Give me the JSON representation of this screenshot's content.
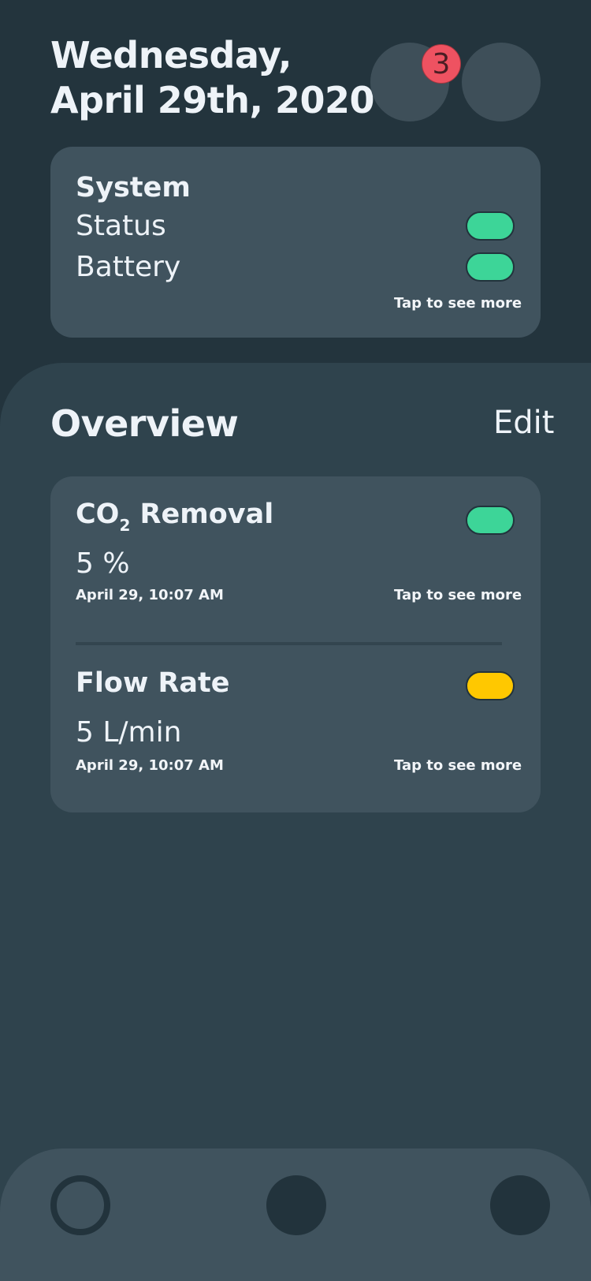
{
  "header": {
    "date_line1": "Wednesday,",
    "date_line2": "April 29th, 2020",
    "notification_count": "3"
  },
  "system_card": {
    "title": "System",
    "status_label": "Status",
    "status_color": "#3dd598",
    "battery_label": "Battery",
    "battery_color": "#3dd598",
    "tap_hint": "Tap to see more"
  },
  "overview": {
    "title": "Overview",
    "edit_label": "Edit",
    "items": [
      {
        "title_prefix": "CO",
        "title_sub": "2",
        "title_suffix": " Removal",
        "value": "5 %",
        "timestamp": "April 29, 10:07 AM",
        "tap_hint": "Tap to see more",
        "status_color": "#3dd598"
      },
      {
        "title": "Flow Rate",
        "value": "5 L/min",
        "timestamp": "April 29, 10:07 AM",
        "tap_hint": "Tap to see more",
        "status_color": "#ffc800"
      }
    ]
  },
  "tabbar": {
    "tabs": [
      {
        "icon": "home-tab-icon",
        "active": true
      },
      {
        "icon": "tab-2-icon",
        "active": false
      },
      {
        "icon": "tab-3-icon",
        "active": false
      }
    ]
  }
}
